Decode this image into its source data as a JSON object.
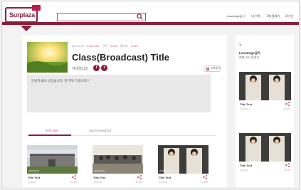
{
  "header": {
    "logo": "Surplaza",
    "nav": [
      "Learnlogs님 ∨",
      "내 이력",
      "구매 결제기",
      "로그인"
    ]
  },
  "channel": {
    "meta": [
      "(channel)",
      "2,222,222",
      "2,222",
      "구독",
      "2,222",
      "좋아요",
      "2,222"
    ],
    "title": "Class(Broadcast) Title",
    "username": "닉네임123",
    "sns": [
      "f",
      "t"
    ],
    "follow_label": "구독하기",
    "description": "안녕하세요! 반갑습니다. 잘 부탁 드립니다^^"
  },
  "tabs": [
    {
      "label": "강의 (26)"
    },
    {
      "label": "Sport News(22)"
    }
  ],
  "videos": [
    {
      "title": "Title Text",
      "date": "2016.06.00",
      "meta": "조회수00",
      "views": "00,000",
      "scene": "building"
    },
    {
      "title": "Title Text",
      "date": "2016.06.00",
      "meta": "조회수00",
      "views": "00,000",
      "scene": "office"
    },
    {
      "title": "Title Text",
      "date": "2016.06.00",
      "meta": "조회수00",
      "views": "00,000",
      "scene": "duo"
    }
  ],
  "sidebar": {
    "arrow": ">",
    "title": "Learnlogs님이",
    "subtitle": "현재 인기 동영상",
    "videos": [
      {
        "title": "Title Text",
        "date": "2016.06.00",
        "meta": "조회수00",
        "views": "00,000"
      },
      {
        "title": "Title Text",
        "date": "2016.06.00",
        "meta": "조회수00",
        "views": "00,000"
      }
    ]
  },
  "colors": {
    "brand": "#8b1d3a",
    "accent": "#c24b6b"
  }
}
